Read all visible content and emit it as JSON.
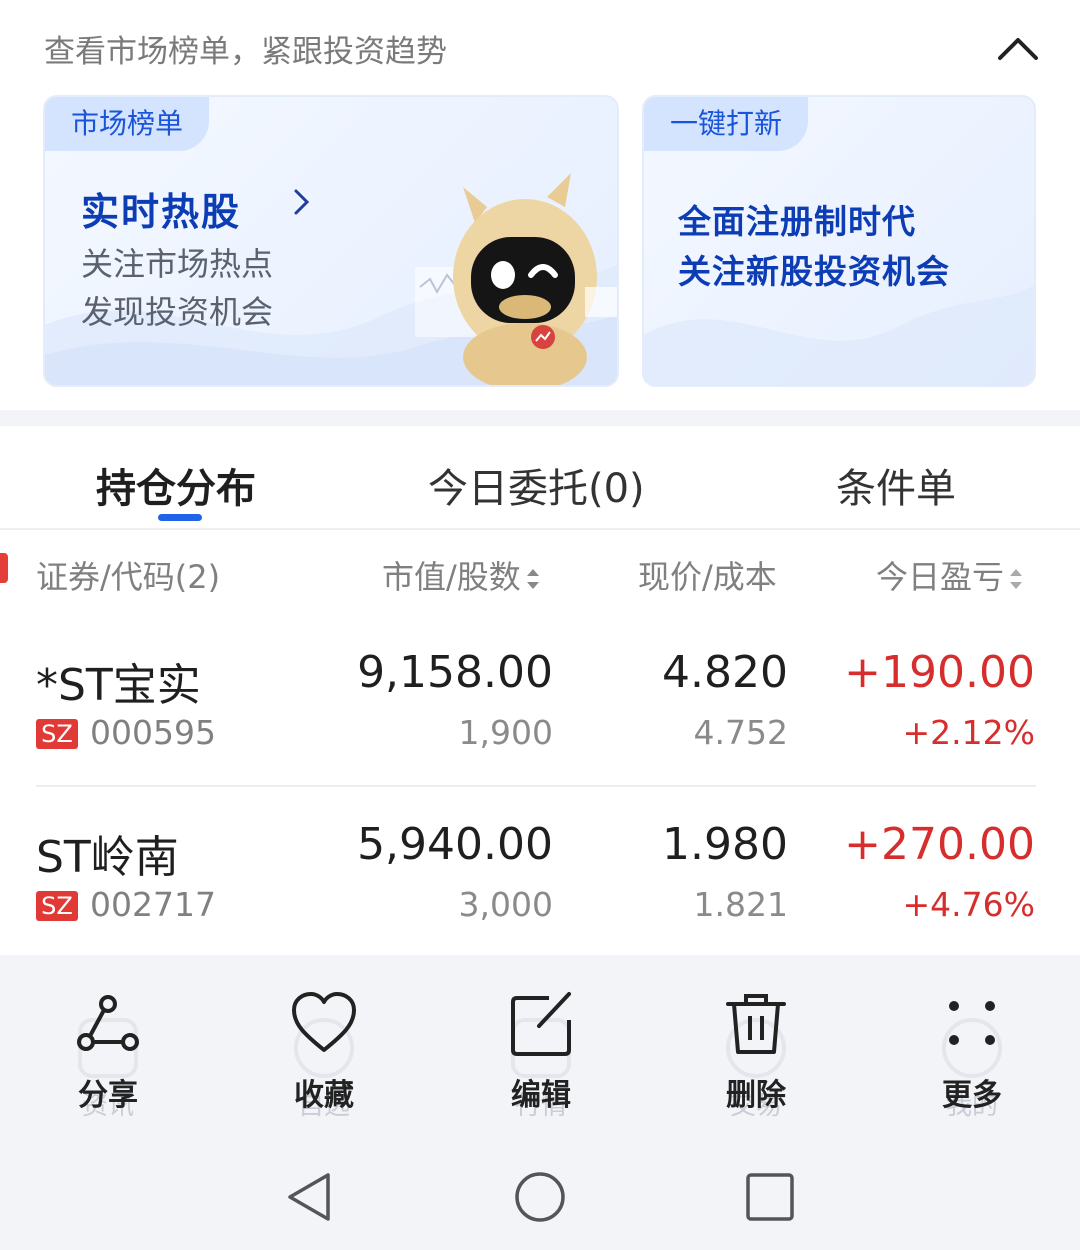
{
  "promo": {
    "hint": "查看市场榜单，紧跟投资趋势",
    "cards": [
      {
        "tag": "市场榜单",
        "title": "实时热股",
        "line1": "关注市场热点",
        "line2": "发现投资机会"
      },
      {
        "tag": "一键打新",
        "line1": "全面注册制时代",
        "line2": "关注新股投资机会"
      }
    ]
  },
  "tabs": [
    {
      "label": "持仓分布",
      "active": true
    },
    {
      "label": "今日委托(0)",
      "active": false
    },
    {
      "label": "条件单",
      "active": false
    }
  ],
  "table": {
    "headers": [
      "证券/代码(2)",
      "市值/股数",
      "现价/成本",
      "今日盈亏"
    ],
    "rows": [
      {
        "name": "*ST宝实",
        "market": "SZ",
        "code": "000595",
        "market_value": "9,158.00",
        "shares": "1,900",
        "price": "4.820",
        "cost": "4.752",
        "pnl": "+190.00",
        "pnl_pct": "+2.12%"
      },
      {
        "name": "ST岭南",
        "market": "SZ",
        "code": "002717",
        "market_value": "5,940.00",
        "shares": "3,000",
        "price": "1.980",
        "cost": "1.821",
        "pnl": "+270.00",
        "pnl_pct": "+4.76%"
      }
    ]
  },
  "actions": [
    {
      "label": "分享",
      "icon": "share-icon"
    },
    {
      "label": "收藏",
      "icon": "heart-icon"
    },
    {
      "label": "编辑",
      "icon": "edit-icon"
    },
    {
      "label": "删除",
      "icon": "trash-icon"
    },
    {
      "label": "更多",
      "icon": "more-icon"
    }
  ],
  "underlying_nav": [
    "资讯",
    "自选",
    "行情",
    "交易",
    "我的"
  ],
  "colors": {
    "accent": "#2163e6",
    "profit_red": "#d62d2d",
    "market_badge": "#e13a36"
  }
}
